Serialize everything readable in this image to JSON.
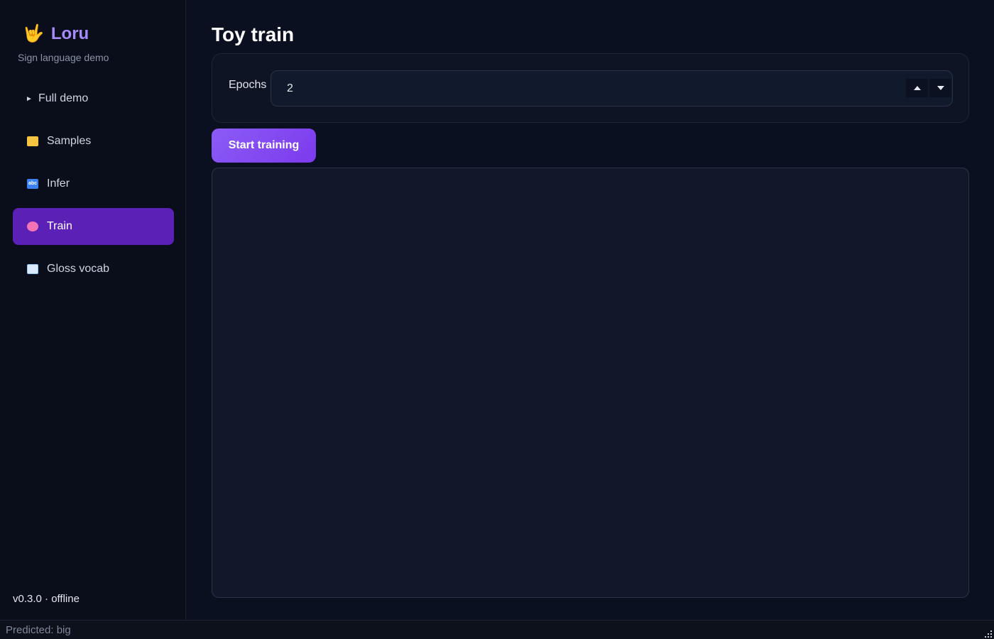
{
  "brand": {
    "icon": "🤟",
    "name": "Loru",
    "subtitle": "Sign language demo"
  },
  "sidebar": {
    "items": [
      {
        "label": "Full demo",
        "icon": "play-triangle-icon",
        "active": false
      },
      {
        "label": "Samples",
        "icon": "folder-icon",
        "active": false
      },
      {
        "label": "Infer",
        "icon": "abc-icon",
        "active": false
      },
      {
        "label": "Train",
        "icon": "brain-icon",
        "active": true
      },
      {
        "label": "Gloss vocab",
        "icon": "book-icon",
        "active": false
      }
    ],
    "version": "v0.3.0 · offline"
  },
  "main": {
    "title": "Toy train",
    "epochs": {
      "label": "Epochs",
      "value": "2"
    },
    "start_button": "Start training"
  },
  "status": {
    "text": "Predicted: big"
  },
  "colors": {
    "accent": "#7c3aed",
    "active_nav": "#5b21b6",
    "brand": "#a78bfa"
  }
}
